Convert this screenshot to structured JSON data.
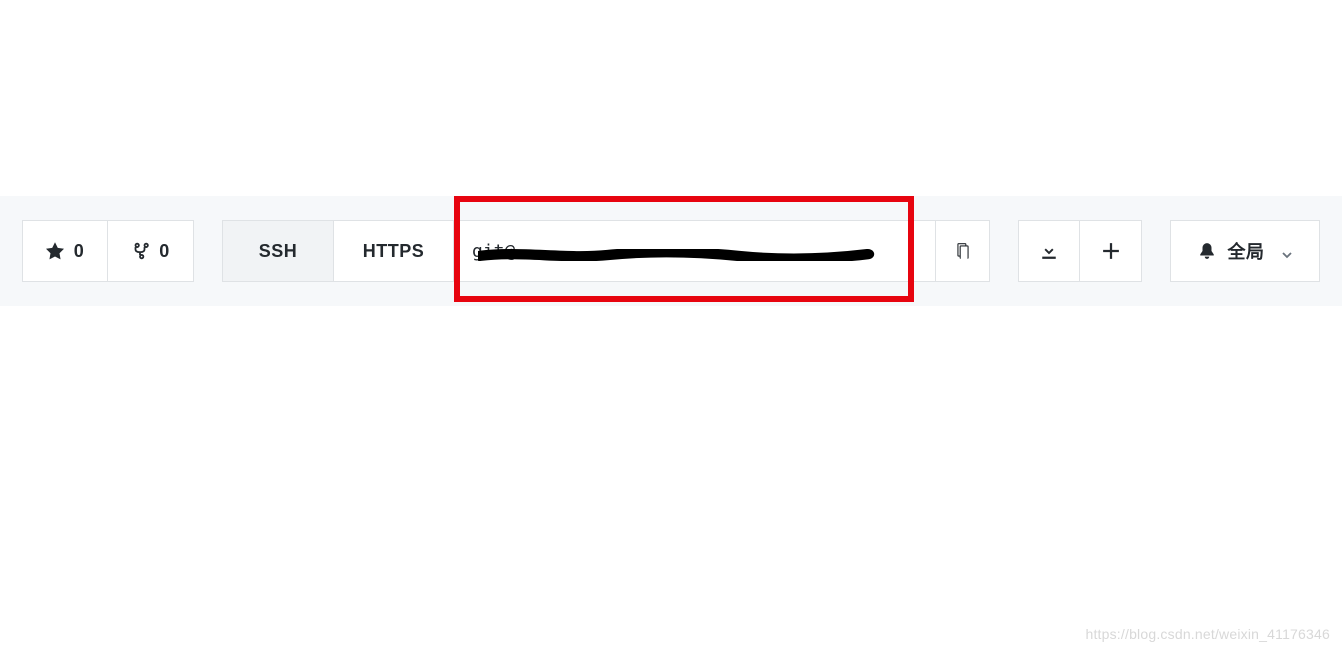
{
  "stats": {
    "star_count": "0",
    "fork_count": "0"
  },
  "clone": {
    "tab_ssh": "SSH",
    "tab_https": "HTTPS",
    "url_value": "git@"
  },
  "notifications": {
    "label": "全局"
  },
  "watermark": "https://blog.csdn.net/weixin_41176346",
  "colors": {
    "highlight": "#e7040f",
    "bar_bg": "#f6f8fa",
    "border": "#dfe2e5"
  }
}
